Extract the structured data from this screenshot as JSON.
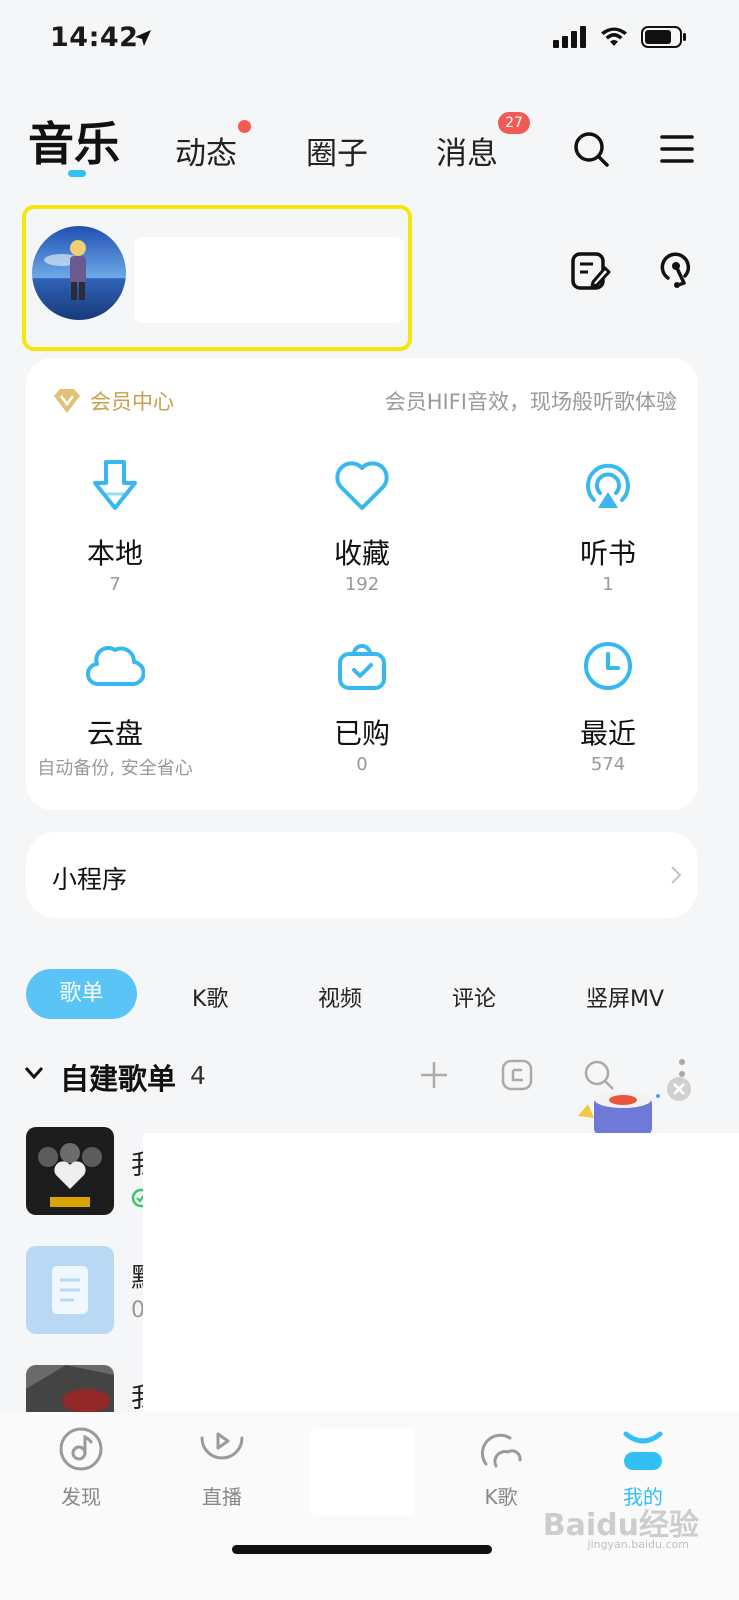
{
  "status_bar": {
    "time": "14:42"
  },
  "header": {
    "tabs": [
      {
        "label": "音乐"
      },
      {
        "label": "动态"
      },
      {
        "label": "圈子"
      },
      {
        "label": "消息"
      }
    ],
    "message_badge": "27"
  },
  "vip": {
    "label": "会员中心",
    "desc": "会员HIFI音效，现场般听歌体验"
  },
  "shortcuts": [
    {
      "label": "本地",
      "count": "7",
      "icon": "download-icon"
    },
    {
      "label": "收藏",
      "count": "192",
      "icon": "heart-icon"
    },
    {
      "label": "听书",
      "count": "1",
      "icon": "audiobook-icon"
    },
    {
      "label": "云盘",
      "count": "自动备份, 安全省心",
      "icon": "cloud-icon"
    },
    {
      "label": "已购",
      "count": "0",
      "icon": "purchased-bag-icon"
    },
    {
      "label": "最近",
      "count": "574",
      "icon": "clock-icon"
    }
  ],
  "mini_program": {
    "label": "小程序"
  },
  "content_tabs": [
    {
      "label": "歌单"
    },
    {
      "label": "K歌"
    },
    {
      "label": "视频"
    },
    {
      "label": "评论"
    },
    {
      "label": "竖屏MV"
    }
  ],
  "playlist_section": {
    "title": "自建歌单",
    "count": "4"
  },
  "playlist_rows": [
    {
      "text": "我",
      "sub": ""
    },
    {
      "text": "默",
      "sub": "0"
    },
    {
      "text": "我",
      "sub": ""
    }
  ],
  "bottom_nav": [
    {
      "label": "发现"
    },
    {
      "label": "直播"
    },
    {
      "label": "K歌"
    },
    {
      "label": "我的"
    }
  ],
  "watermark": {
    "main": "Baidu经验",
    "sub": "jingyan.baidu.com"
  },
  "colors": {
    "accent": "#31c0f5",
    "vip_gold": "#c9a04d",
    "badge_red": "#f25b55",
    "highlight": "#f7e60e"
  }
}
